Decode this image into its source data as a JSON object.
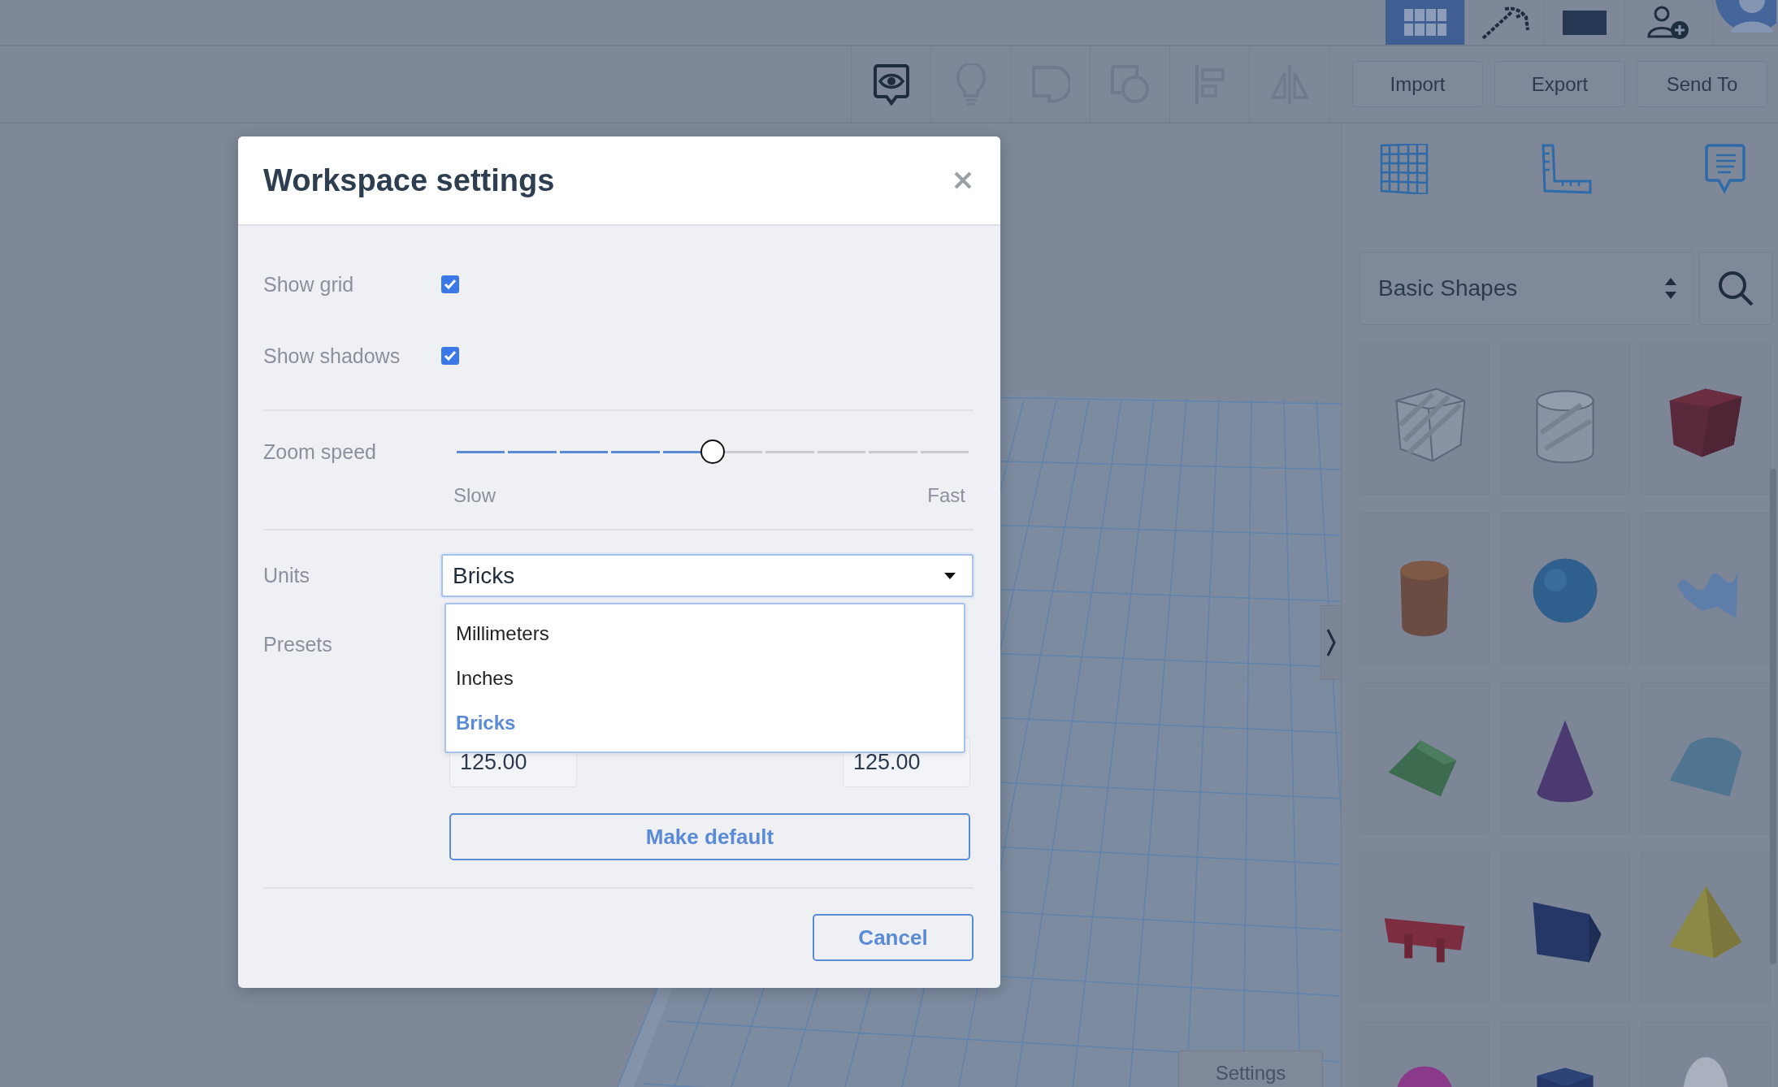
{
  "top_bar": {
    "view_modes": [
      {
        "selected": true
      },
      {
        "selected": false
      },
      {
        "selected": false
      }
    ]
  },
  "toolbar": {
    "tools": [
      {
        "disabled": false
      },
      {
        "disabled": true
      },
      {
        "disabled": true
      },
      {
        "disabled": true
      },
      {
        "disabled": true
      },
      {
        "disabled": true
      }
    ],
    "buttons": [
      "Import",
      "Export",
      "Send To"
    ]
  },
  "dialog": {
    "title": "Workspace settings",
    "checkboxes": [
      {
        "label": "Show grid",
        "checked": true
      },
      {
        "label": "Show shadows",
        "checked": true
      }
    ],
    "zoom_speed": {
      "label": "Zoom speed",
      "level": 0.5,
      "min_label": "Slow",
      "max_label": "Fast"
    },
    "units": {
      "label": "Units",
      "value": "Bricks",
      "expanded": true,
      "options": [
        {
          "label": "Millimeters",
          "selected": false
        },
        {
          "label": "Inches",
          "selected": false
        },
        {
          "label": "Bricks",
          "selected": true
        }
      ]
    },
    "presets": {
      "label": "Presets",
      "fields": [
        "125.00",
        "125.00"
      ]
    },
    "make_default": "Make default",
    "cancel": "Cancel"
  },
  "shape_panel": {
    "category": "Basic Shapes"
  },
  "settings_button": "Settings"
}
